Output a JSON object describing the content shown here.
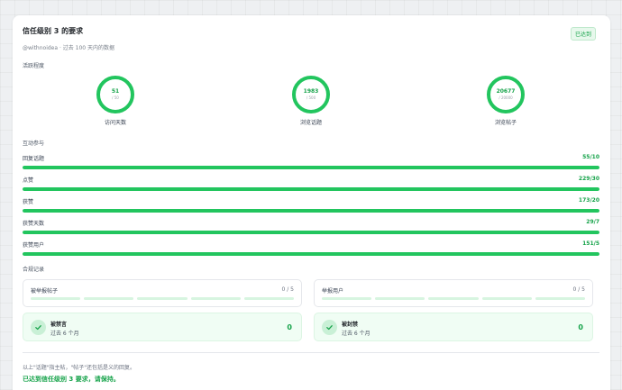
{
  "header": {
    "title": "信任级别 3 的要求",
    "badge": "已达到",
    "subtitle": "@withnoidea · 过去 100 天内的数据"
  },
  "sections": {
    "activity": "活跃程度",
    "interaction": "互动参与",
    "compliance": "合规记录"
  },
  "rings": [
    {
      "value": "51",
      "target": "/ 50",
      "label": "访问天数",
      "progress": 1.0
    },
    {
      "value": "1983",
      "target": "/ 500",
      "label": "浏览话题",
      "progress": 1.0
    },
    {
      "value": "20677",
      "target": "/ 20000",
      "label": "浏览帖子",
      "progress": 1.0
    }
  ],
  "bars": [
    {
      "label": "回复话题",
      "value": "55/10",
      "progress": 1.0
    },
    {
      "label": "点赞",
      "value": "229/30",
      "progress": 1.0
    },
    {
      "label": "获赞",
      "value": "173/20",
      "progress": 1.0
    },
    {
      "label": "获赞天数",
      "value": "29/7",
      "progress": 1.0
    },
    {
      "label": "获赞用户",
      "value": "151/5",
      "progress": 1.0
    }
  ],
  "reports": [
    {
      "label": "被举报帖子",
      "count": "0 / 5"
    },
    {
      "label": "举报用户",
      "count": "0 / 5"
    }
  ],
  "penalties": [
    {
      "label": "被禁言",
      "period": "过去 6 个月",
      "value": "0"
    },
    {
      "label": "被封禁",
      "period": "过去 6 个月",
      "value": "0"
    }
  ],
  "footer": {
    "note": "以上\"话题\"指主帖，\"帖子\"还包括是义的回复。",
    "status": "已达到信任级别 3 要求，请保持。"
  },
  "colors": {
    "accent": "#22c55e",
    "accent_text": "#16a34a",
    "accent_light": "#dcfce7"
  }
}
